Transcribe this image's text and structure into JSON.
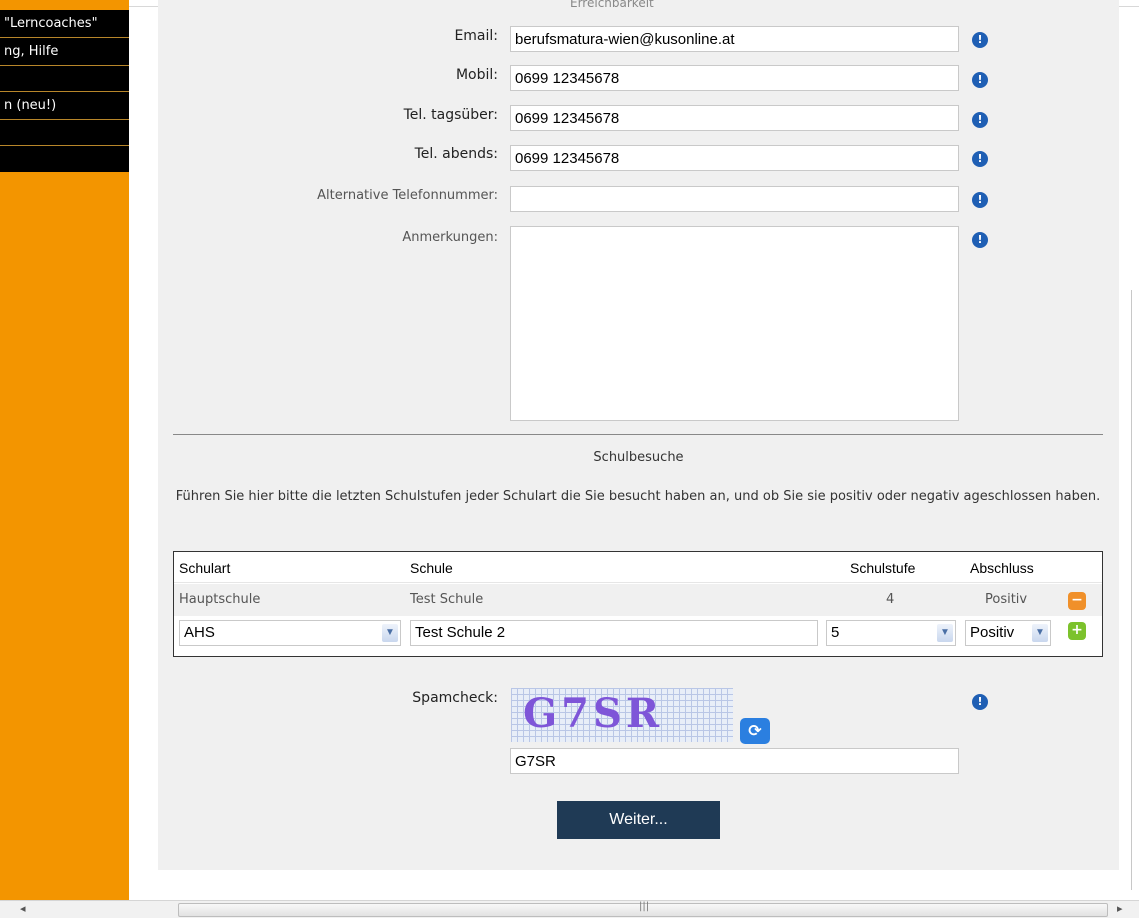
{
  "sidebar": {
    "items": [
      "\"Lerncoaches\"",
      "ng, Hilfe",
      "",
      "n (neu!)",
      "",
      ""
    ]
  },
  "section_top": {
    "legend": "Erreichbarkeit"
  },
  "form": {
    "email": {
      "label": "Email:",
      "value": "berufsmatura-wien@kusonline.at"
    },
    "mobil": {
      "label": "Mobil:",
      "value": "0699 12345678"
    },
    "tel_tag": {
      "label": "Tel. tagsüber:",
      "value": "0699 12345678"
    },
    "tel_abend": {
      "label": "Tel. abends:",
      "value": "0699 12345678"
    },
    "alt_tel": {
      "label": "Alternative Telefonnummer:",
      "value": ""
    },
    "anmerkungen": {
      "label": "Anmerkungen:",
      "value": ""
    }
  },
  "schulbesuche": {
    "title": "Schulbesuche",
    "description": "Führen Sie hier bitte die letzten Schulstufen jeder Schulart die Sie besucht haben an, und ob Sie sie positiv oder negativ ageschlossen haben.",
    "headers": {
      "schulart": "Schulart",
      "schule": "Schule",
      "schulstufe": "Schulstufe",
      "abschluss": "Abschluss"
    },
    "row": {
      "schulart": "Hauptschule",
      "schule": "Test Schule",
      "schulstufe": "4",
      "abschluss": "Positiv"
    },
    "new_row": {
      "schulart": "AHS",
      "schule": "Test Schule 2",
      "schulstufe": "5",
      "abschluss": "Positiv"
    }
  },
  "spamcheck": {
    "label": "Spamcheck:",
    "captcha_text": "G7SR",
    "value": "G7SR"
  },
  "submit": {
    "label": "Weiter..."
  },
  "icons": {
    "info": "info-icon",
    "refresh": "refresh-icon",
    "minus": "remove-row-icon",
    "plus": "add-row-icon"
  },
  "colors": {
    "sidebar": "#f39500",
    "button": "#1f3a55",
    "info": "#1f5fb4"
  }
}
